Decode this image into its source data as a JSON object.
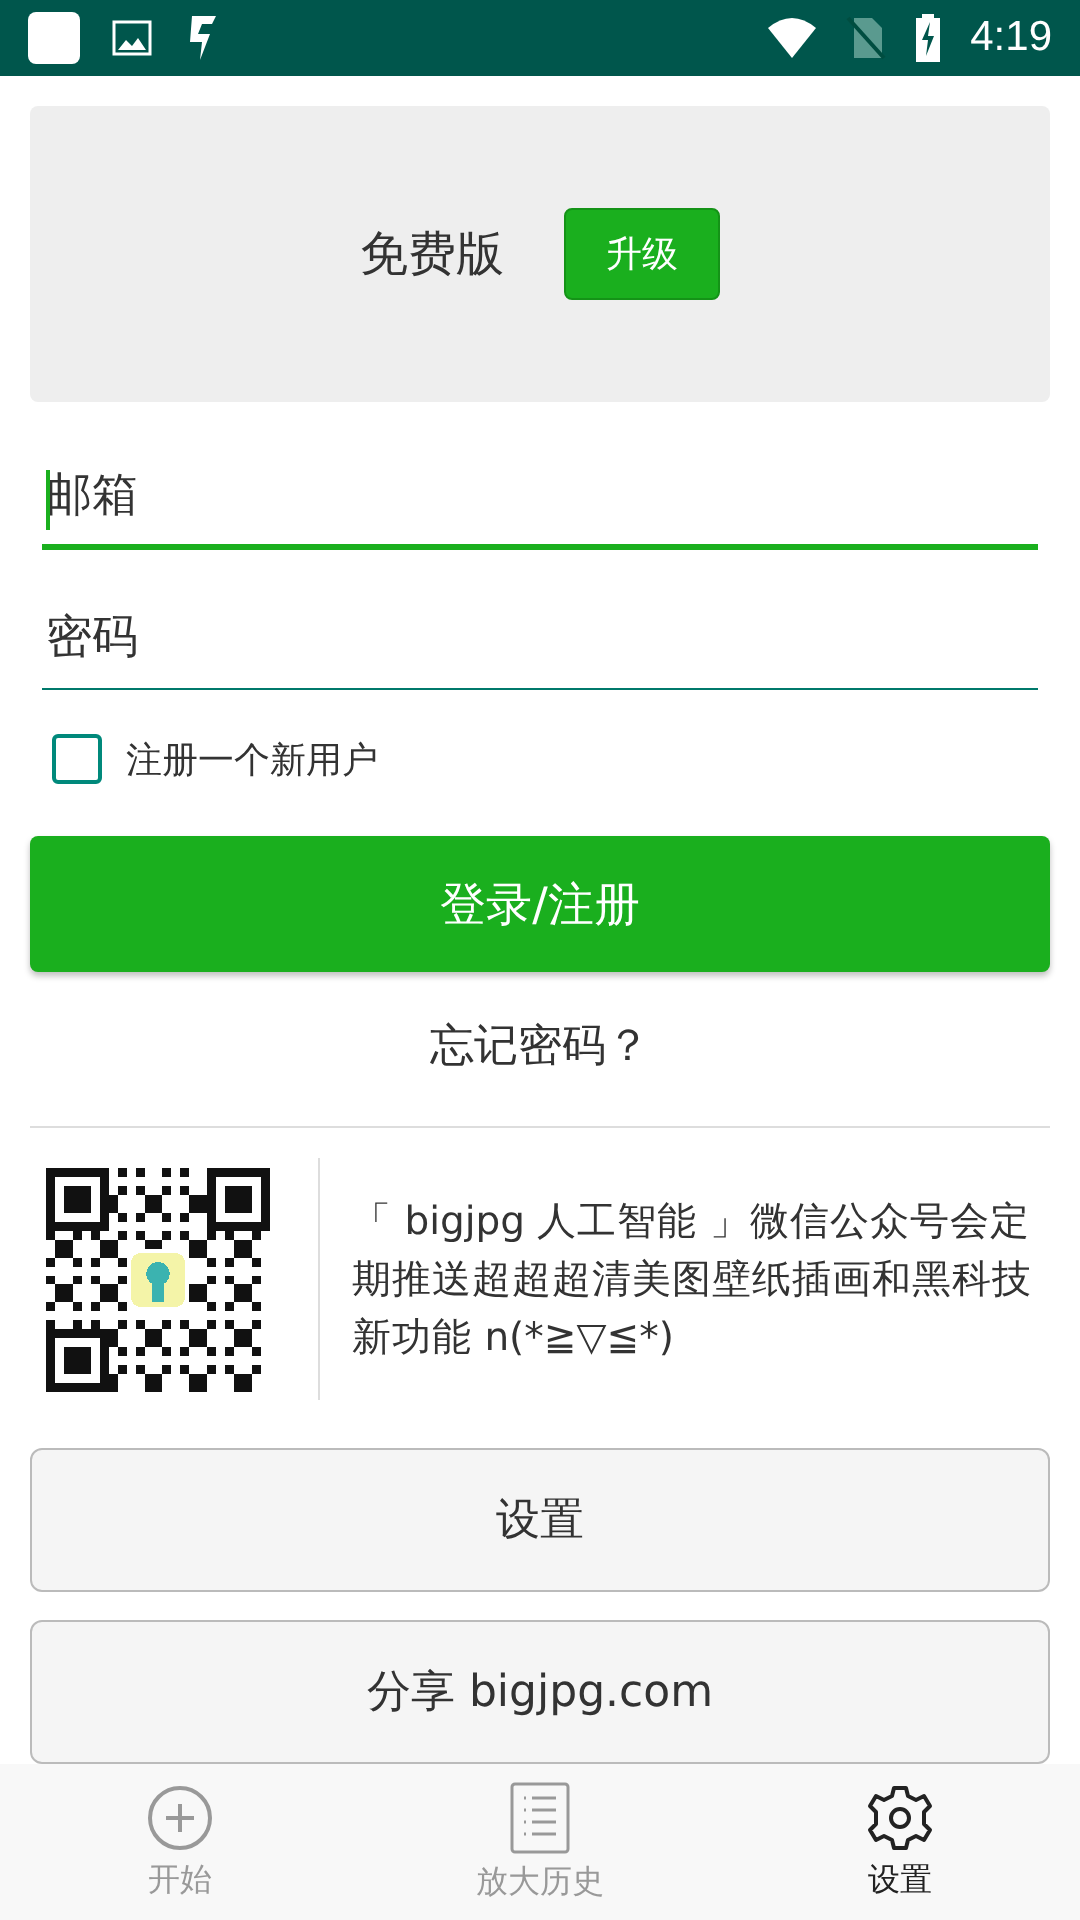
{
  "status_bar": {
    "time": "4:19"
  },
  "plan": {
    "label": "免费版",
    "upgrade_button": "升级"
  },
  "email_field": {
    "placeholder": "邮箱",
    "focused": true
  },
  "password_field": {
    "placeholder": "密码",
    "focused": false
  },
  "register_checkbox": {
    "label": "注册一个新用户",
    "checked": false
  },
  "login_button": "登录/注册",
  "forgot_link": "忘记密码？",
  "promo": {
    "text": "「 bigjpg 人工智能 」微信公众号会定期推送超超超清美图壁纸插画和黑科技新功能 n(*≧▽≦*)"
  },
  "buttons": [
    "设置",
    "分享 bigjpg.com"
  ],
  "bottom_nav": [
    {
      "label": "开始",
      "kind": "plus",
      "selected": false
    },
    {
      "label": "放大历史",
      "kind": "list",
      "selected": false
    },
    {
      "label": "设置",
      "kind": "gear",
      "selected": true
    }
  ]
}
